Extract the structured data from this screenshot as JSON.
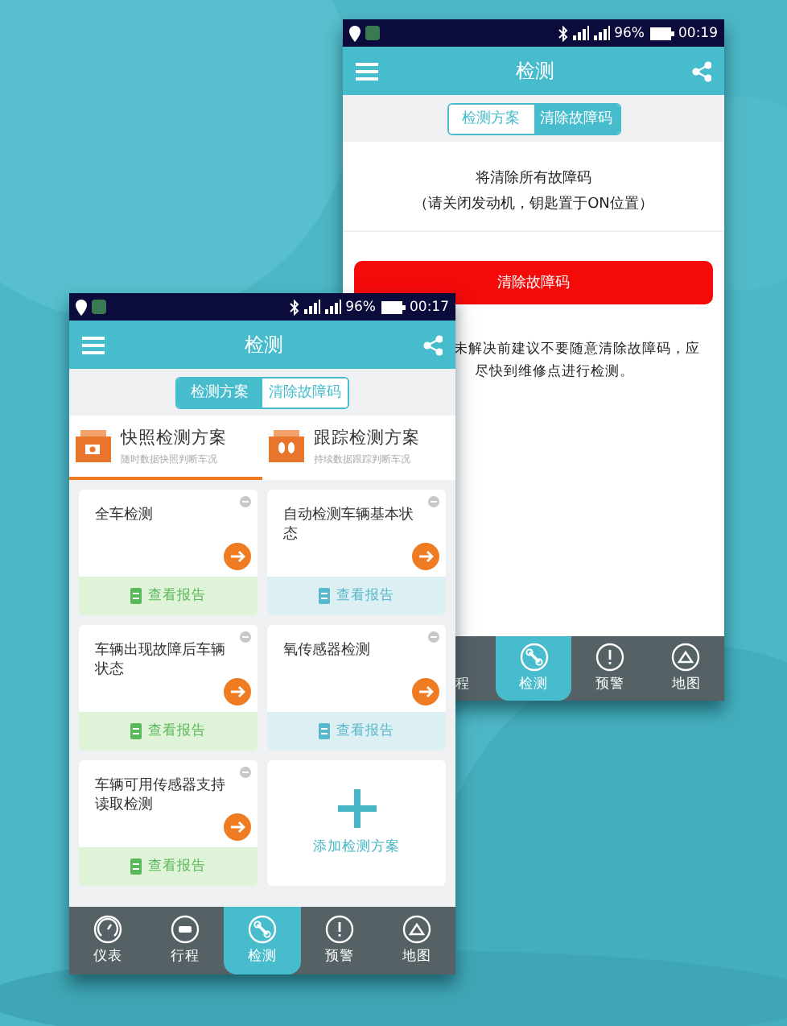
{
  "back_phone": {
    "status_bar": {
      "battery": "96%",
      "time": "00:19"
    },
    "header": {
      "title": "检测"
    },
    "tabs": [
      {
        "label": "检测方案",
        "selected": false
      },
      {
        "label": "清除故障码",
        "selected": true
      }
    ],
    "message": [
      "将清除所有故障码",
      "（请关闭发动机，钥匙置于ON位置）"
    ],
    "clear_button": "清除故障码",
    "warning": [
      "未解决前建议不要随意清除故障码，应",
      "尽快到维修点进行检测。"
    ],
    "nav": [
      {
        "label": "程",
        "selected": false
      },
      {
        "label": "检测",
        "kind": "wrench",
        "selected": true
      },
      {
        "label": "预警",
        "kind": "alert",
        "selected": false
      },
      {
        "label": "地图",
        "kind": "map",
        "selected": false
      }
    ]
  },
  "front_phone": {
    "status_bar": {
      "battery": "96%",
      "time": "00:17"
    },
    "header": {
      "title": "检测"
    },
    "tabs": [
      {
        "label": "检测方案",
        "selected": true
      },
      {
        "label": "清除故障码",
        "selected": false
      }
    ],
    "plan_tabs": [
      {
        "title": "快照检测方案",
        "subtitle": "随时数据快照判断车况",
        "kind": "camera",
        "selected": true
      },
      {
        "title": "跟踪检测方案",
        "subtitle": "持续数据跟踪判断车况",
        "kind": "steps",
        "selected": false
      }
    ],
    "cards": [
      {
        "kind": "plan",
        "title": "全车检测",
        "report": "查看报告",
        "color": "#dff3d9"
      },
      {
        "kind": "plan",
        "title": "自动检测车辆基本状态",
        "report": "查看报告",
        "color": "#dcf0f4"
      },
      {
        "kind": "plan",
        "title": "车辆出现故障后车辆状态",
        "report": "查看报告",
        "color": "#dff3d9"
      },
      {
        "kind": "plan",
        "title": "氧传感器检测",
        "report": "查看报告",
        "color": "#dcf0f4"
      },
      {
        "kind": "plan",
        "title": "车辆可用传感器支持读取检测",
        "report": "查看报告",
        "color": "#dff3d9"
      },
      {
        "kind": "add",
        "title": "添加检测方案"
      }
    ],
    "nav": [
      {
        "label": "仪表",
        "kind": "gauge",
        "selected": false
      },
      {
        "label": "行程",
        "kind": "trip",
        "selected": false
      },
      {
        "label": "检测",
        "kind": "wrench",
        "selected": true
      },
      {
        "label": "预警",
        "kind": "alert",
        "selected": false
      },
      {
        "label": "地图",
        "kind": "map",
        "selected": false
      }
    ]
  }
}
